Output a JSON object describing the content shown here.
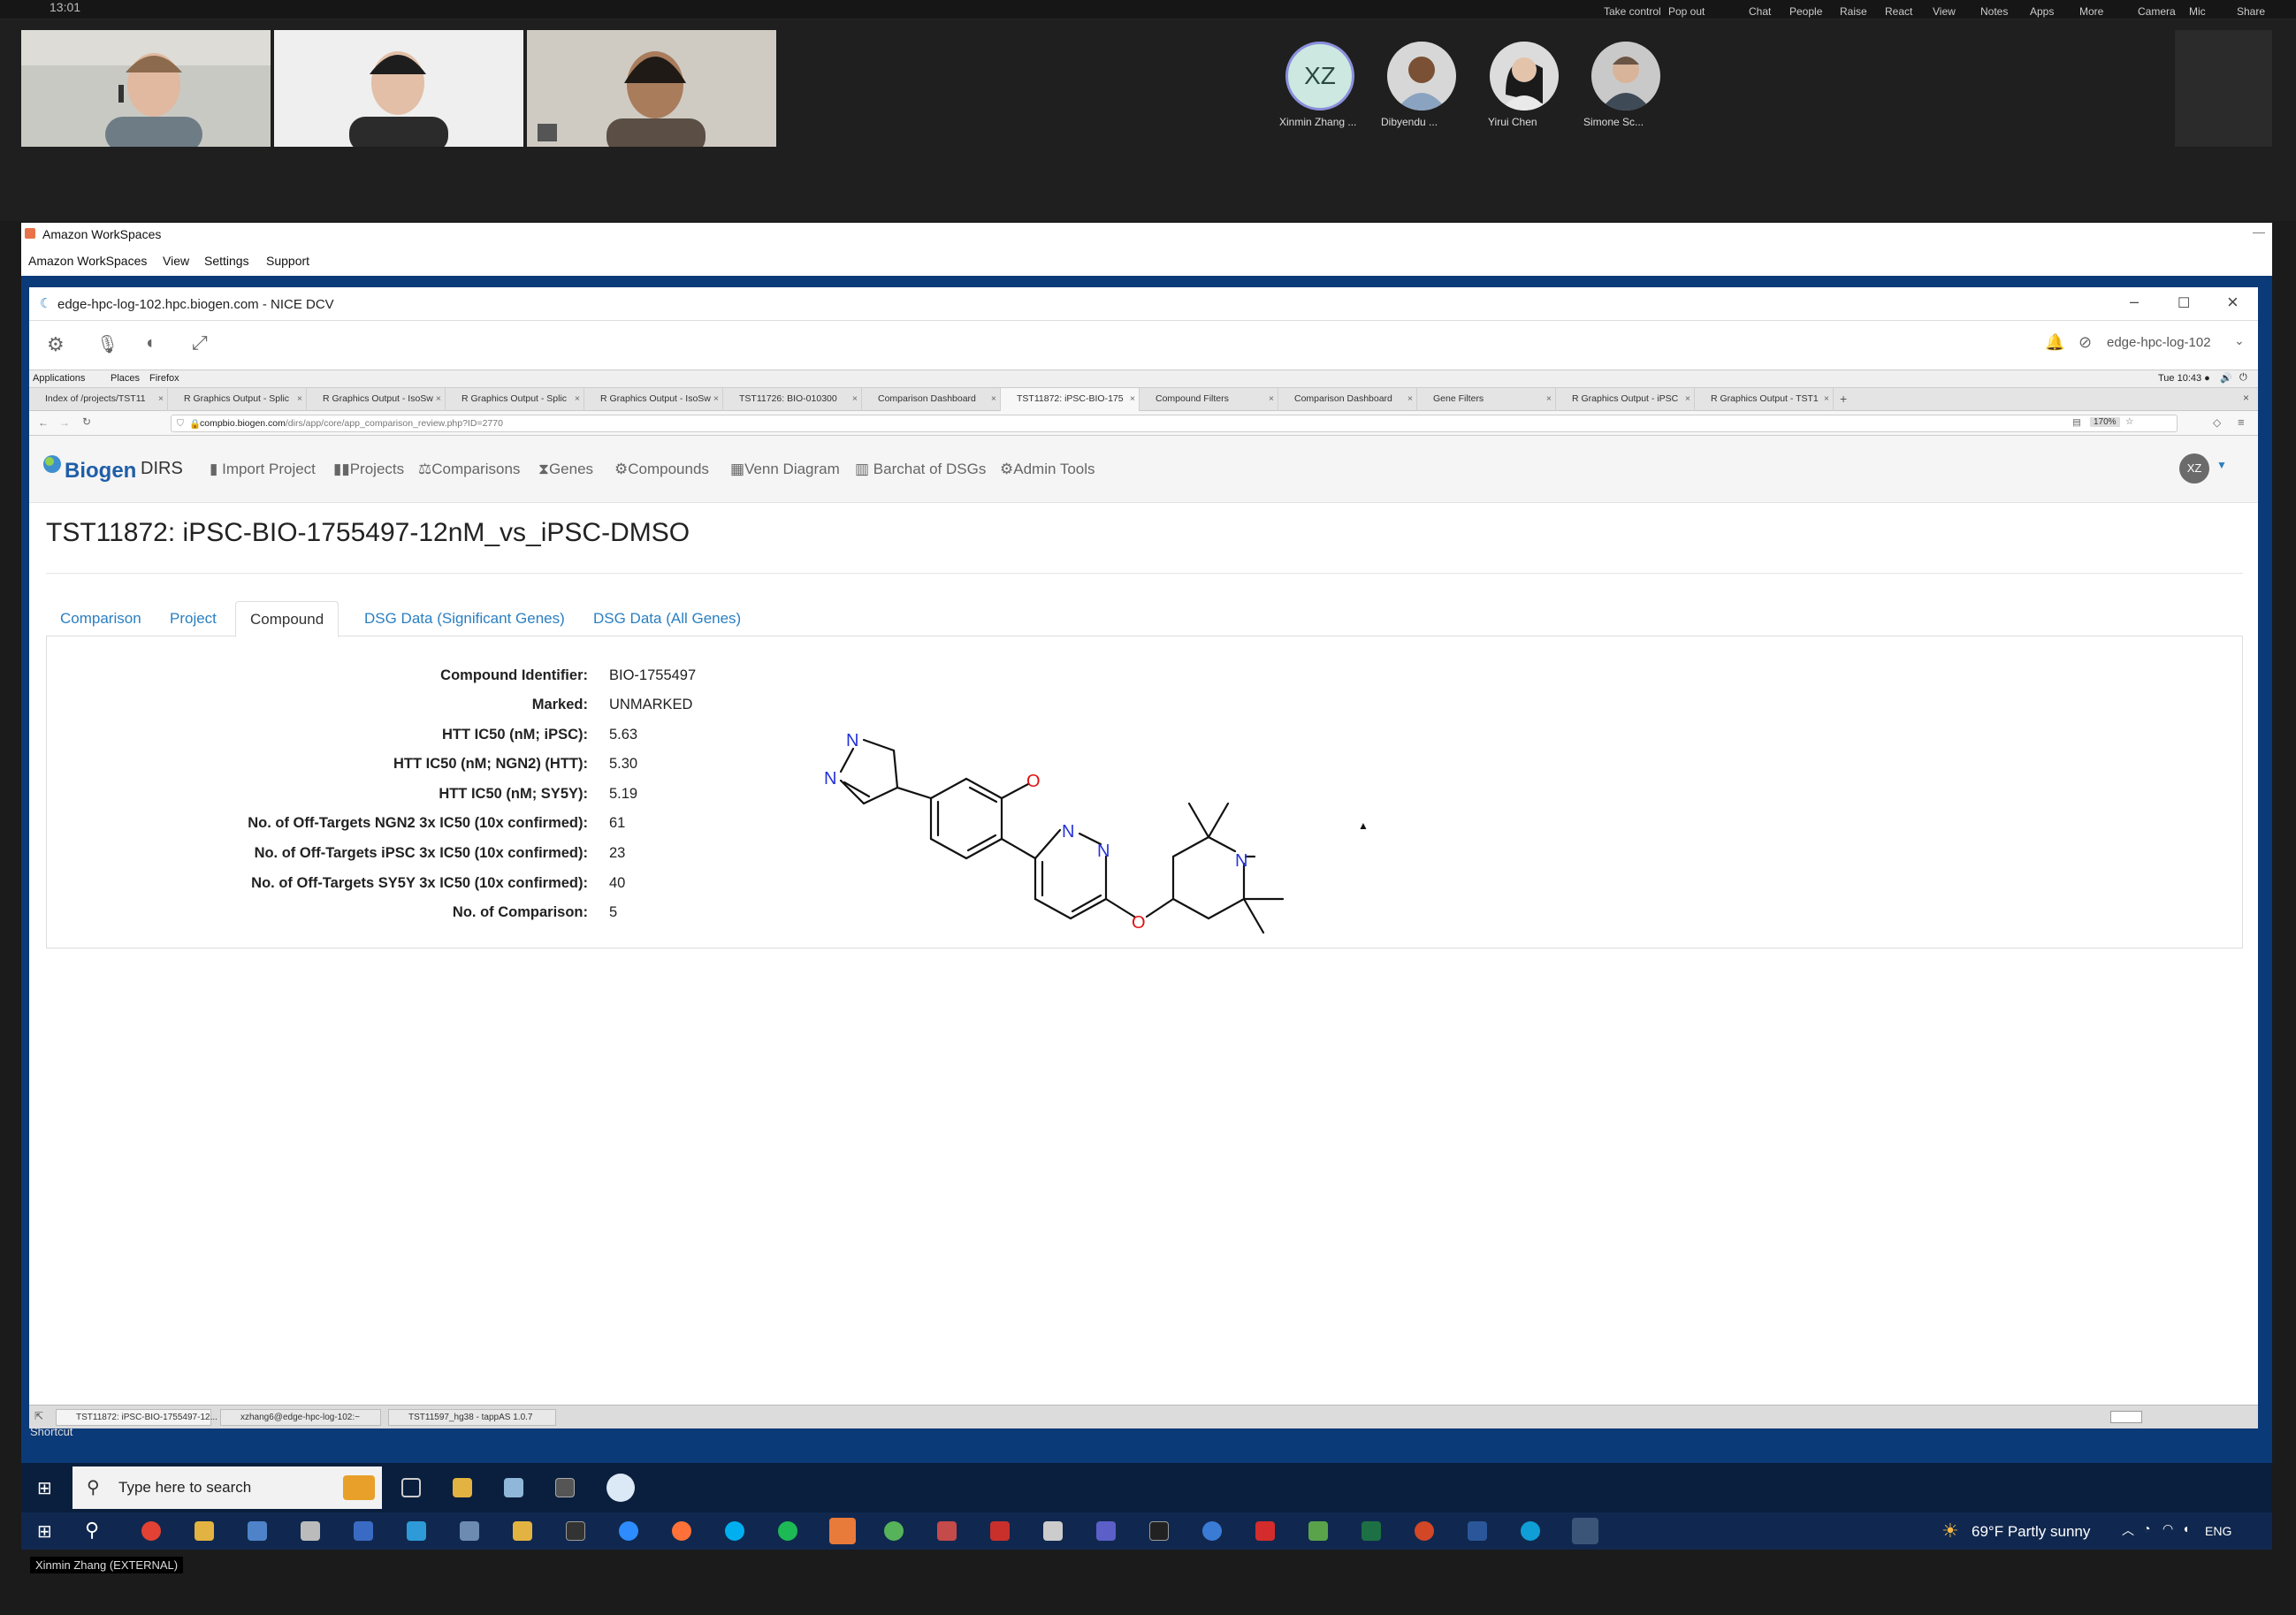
{
  "teams": {
    "time": "13:01",
    "controls": [
      {
        "label": "Take control",
        "icon": "take-control-icon"
      },
      {
        "label": "Pop out",
        "icon": "pop-out-icon"
      },
      {
        "label": "Chat",
        "icon": "chat-icon"
      },
      {
        "label": "People",
        "icon": "people-icon"
      },
      {
        "label": "Raise",
        "icon": "raise-hand-icon"
      },
      {
        "label": "React",
        "icon": "react-icon"
      },
      {
        "label": "View",
        "icon": "view-icon"
      },
      {
        "label": "Notes",
        "icon": "notes-icon"
      },
      {
        "label": "Apps",
        "icon": "apps-icon"
      },
      {
        "label": "More",
        "icon": "more-icon"
      },
      {
        "label": "Camera",
        "icon": "camera-icon"
      },
      {
        "label": "Mic",
        "icon": "mic-icon"
      },
      {
        "label": "Share",
        "icon": "share-icon"
      }
    ],
    "participants": [
      {
        "initials": "XZ",
        "name": "Xinmin Zhang ..."
      },
      {
        "name": "Dibyendu ..."
      },
      {
        "name": "Yirui Chen"
      },
      {
        "name": "Simone Sc..."
      }
    ],
    "bottom_name": "Xinmin Zhang (EXTERNAL)"
  },
  "workspaces": {
    "title": "Amazon WorkSpaces",
    "menu": [
      "Amazon WorkSpaces",
      "View",
      "Settings",
      "Support"
    ]
  },
  "dcv": {
    "title": "edge-hpc-log-102.hpc.biogen.com - NICE DCV",
    "host": "edge-hpc-log-102"
  },
  "gnome": {
    "menu": [
      "Applications",
      "Places",
      "Firefox"
    ],
    "clock": "Tue 10:43 ●"
  },
  "firefox": {
    "tabs": [
      "Index of /projects/TST11",
      "R Graphics Output - Splic",
      "R Graphics Output - IsoSw",
      "R Graphics Output - Splic",
      "R Graphics Output - IsoSw",
      "TST11726: BIO-010300",
      "Comparison Dashboard",
      "TST11872: iPSC-BIO-175",
      "Compound Filters",
      "Comparison Dashboard",
      "Gene Filters",
      "R Graphics Output - iPSC",
      "R Graphics Output - TST1"
    ],
    "url_host": "compbio.biogen.com",
    "url_path": "/dirs/app/core/app_comparison_review.php?ID=2770",
    "zoom": "170%",
    "status_tasks": [
      "TST11872: iPSC-BIO-1755497-12...",
      "xzhang6@edge-hpc-log-102:~",
      "TST11597_hg38 - tappAS 1.0.7"
    ]
  },
  "app": {
    "brand": "Biogen",
    "product": "DIRS",
    "nav": [
      {
        "label": "Import Project",
        "icon": "file-icon"
      },
      {
        "label": "Projects",
        "icon": "book-icon"
      },
      {
        "label": "Comparisons",
        "icon": "balance-icon"
      },
      {
        "label": "Genes",
        "icon": "hourglass-icon"
      },
      {
        "label": "Compounds",
        "icon": "gear-icon"
      },
      {
        "label": "Venn Diagram",
        "icon": "table-icon"
      },
      {
        "label": "Barchat of DSGs",
        "icon": "barchart-icon"
      },
      {
        "label": "Admin Tools",
        "icon": "cog-icon"
      }
    ],
    "user_initials": "XZ",
    "page_title": "TST11872: iPSC-BIO-1755497-12nM_vs_iPSC-DMSO",
    "tabs": [
      "Comparison",
      "Project",
      "Compound",
      "DSG Data (Significant Genes)",
      "DSG Data (All Genes)"
    ],
    "active_tab": "Compound",
    "compound": [
      {
        "label": "Compound Identifier:",
        "value": "BIO-1755497"
      },
      {
        "label": "Marked:",
        "value": "UNMARKED"
      },
      {
        "label": "HTT IC50 (nM; iPSC):",
        "value": "5.63"
      },
      {
        "label": "HTT IC50 (nM; NGN2) (HTT):",
        "value": "5.30"
      },
      {
        "label": "HTT IC50 (nM; SY5Y):",
        "value": "5.19"
      },
      {
        "label": "No. of Off-Targets NGN2 3x IC50 (10x confirmed):",
        "value": "61"
      },
      {
        "label": "No. of Off-Targets iPSC 3x IC50 (10x confirmed):",
        "value": "23"
      },
      {
        "label": "No. of Off-Targets SY5Y 3x IC50 (10x confirmed):",
        "value": "40"
      },
      {
        "label": "No. of Comparison:",
        "value": "5"
      }
    ],
    "molecule_atoms": {
      "n1": "N",
      "n2": "N",
      "o1": "O",
      "n3": "N",
      "n4": "N",
      "o2": "O",
      "n5": "N"
    },
    "colors": {
      "link": "#2a7fc1",
      "nitrogen": "#2433d6",
      "oxygen": "#e01010"
    }
  },
  "windows": {
    "search_placeholder": "Type here to search",
    "weather": "69°F  Partly sunny",
    "lang": "ENG",
    "shortcut_label": "Shortcut"
  }
}
